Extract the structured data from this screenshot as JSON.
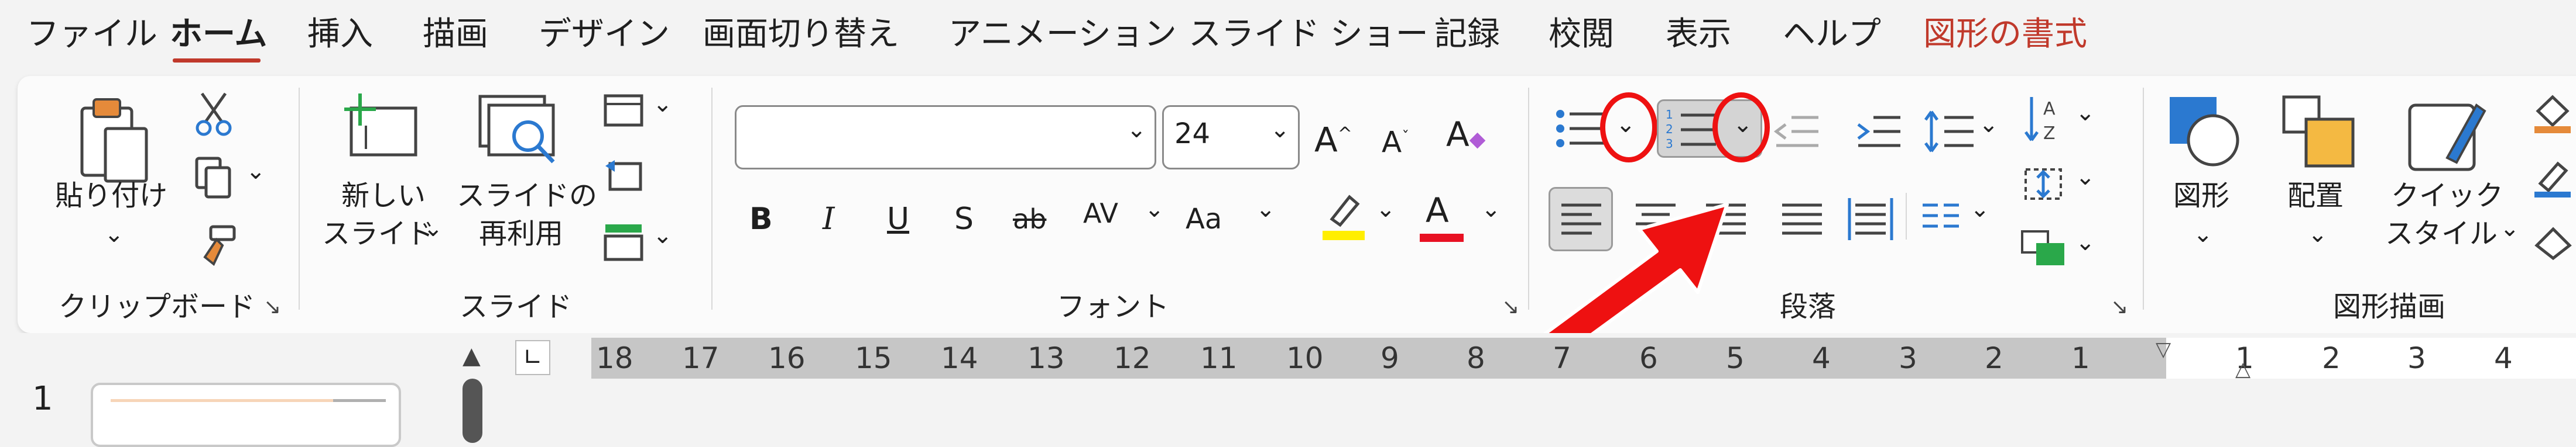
{
  "tabs": [
    "ファイル",
    "ホーム",
    "挿入",
    "描画",
    "デザイン",
    "画面切り替え",
    "アニメーション",
    "スライド ショー",
    "記録",
    "校閲",
    "表示",
    "ヘルプ",
    "図形の書式"
  ],
  "groups": {
    "clipboard": {
      "label": "クリップボード",
      "paste": "貼り付け"
    },
    "slides": {
      "label": "スライド",
      "new_slide_1": "新しい",
      "new_slide_2": "スライド",
      "reuse_1": "スライドの",
      "reuse_2": "再利用"
    },
    "font": {
      "label": "フォント",
      "font_name": "",
      "font_size": "24"
    },
    "paragraph": {
      "label": "段落"
    },
    "drawing": {
      "label": "図形描画",
      "shapes": "図形",
      "arrange": "配置",
      "quick_style_1": "クイック",
      "quick_style_2": "スタイル"
    }
  },
  "ruler": {
    "left_ticks": [
      "18",
      "17",
      "16",
      "15",
      "14",
      "13",
      "12",
      "11",
      "10",
      "9",
      "8",
      "7",
      "6",
      "5",
      "4",
      "3",
      "2",
      "1"
    ],
    "right_ticks": [
      "1",
      "2",
      "3",
      "4"
    ]
  },
  "slide_panel": {
    "slide_number": "1"
  },
  "colors": {
    "accent": "#c0392b",
    "annotation": "#ee1111",
    "highlight": "#ffee00",
    "font_color": "#e81123"
  }
}
